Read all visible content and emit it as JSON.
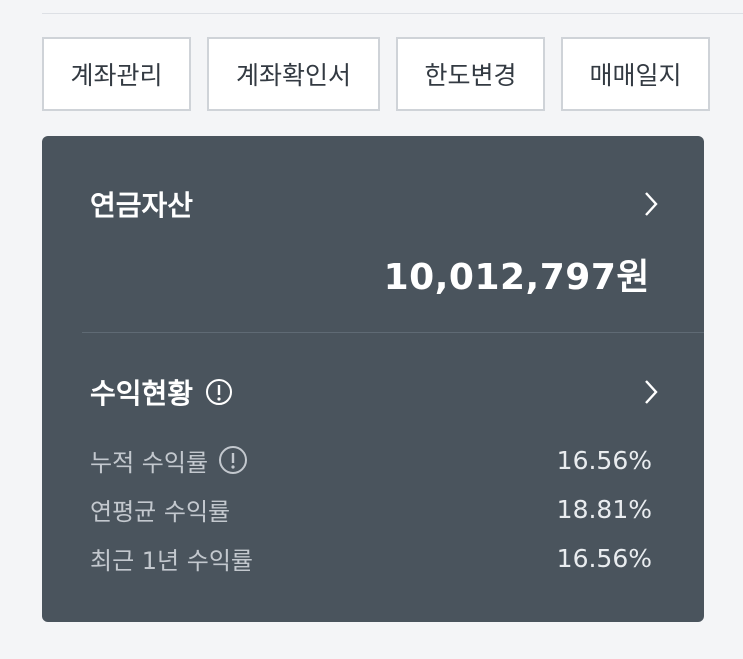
{
  "buttons": {
    "account_manage": "계좌관리",
    "account_certificate": "계좌확인서",
    "limit_change": "한도변경",
    "trading_journal": "매매일지"
  },
  "pension_assets": {
    "title": "연금자산",
    "amount": "10,012,797원"
  },
  "profit_status": {
    "title": "수익현황",
    "rows": [
      {
        "label": "누적 수익률",
        "value": "16.56%"
      },
      {
        "label": "연평균 수익률",
        "value": "18.81%"
      },
      {
        "label": "최근 1년 수익률",
        "value": "16.56%"
      }
    ]
  },
  "colors": {
    "card_bg": "#4a545d",
    "page_bg": "#f4f5f7",
    "button_border": "#cfd3d8"
  }
}
